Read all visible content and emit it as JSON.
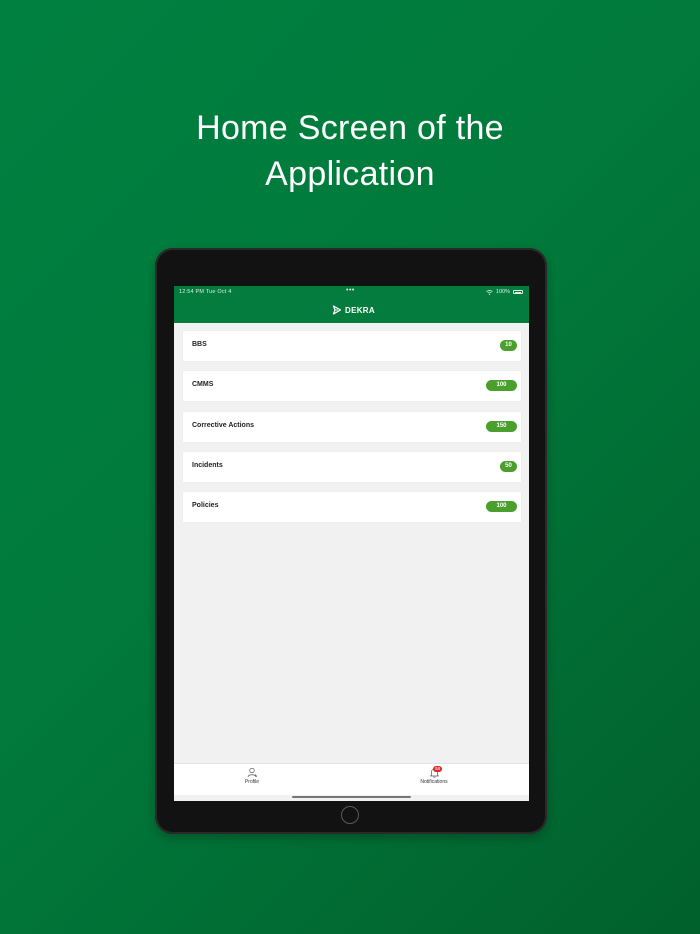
{
  "headline": {
    "line1": "Home Screen of the",
    "line2": "Application"
  },
  "status_bar": {
    "time": "12:54 PM   Tue Oct 4",
    "battery": "100%"
  },
  "brand": {
    "name": "DEKRA",
    "icon": "dekra-logo-icon"
  },
  "modules": [
    {
      "label": "BBS",
      "count": "10"
    },
    {
      "label": "CMMS",
      "count": "100"
    },
    {
      "label": "Corrective Actions",
      "count": "150"
    },
    {
      "label": "Incidents",
      "count": "50"
    },
    {
      "label": "Policies",
      "count": "100"
    }
  ],
  "tabbar": {
    "profile": {
      "label": "Profile",
      "icon": "user-icon"
    },
    "notifications": {
      "label": "Notifications",
      "icon": "bell-icon",
      "badge": "58"
    }
  },
  "colors": {
    "background_green": "#017a3b",
    "navbar_green": "#047c3d",
    "badge_green": "#4b9f2c",
    "notification_red": "#e0262b"
  }
}
